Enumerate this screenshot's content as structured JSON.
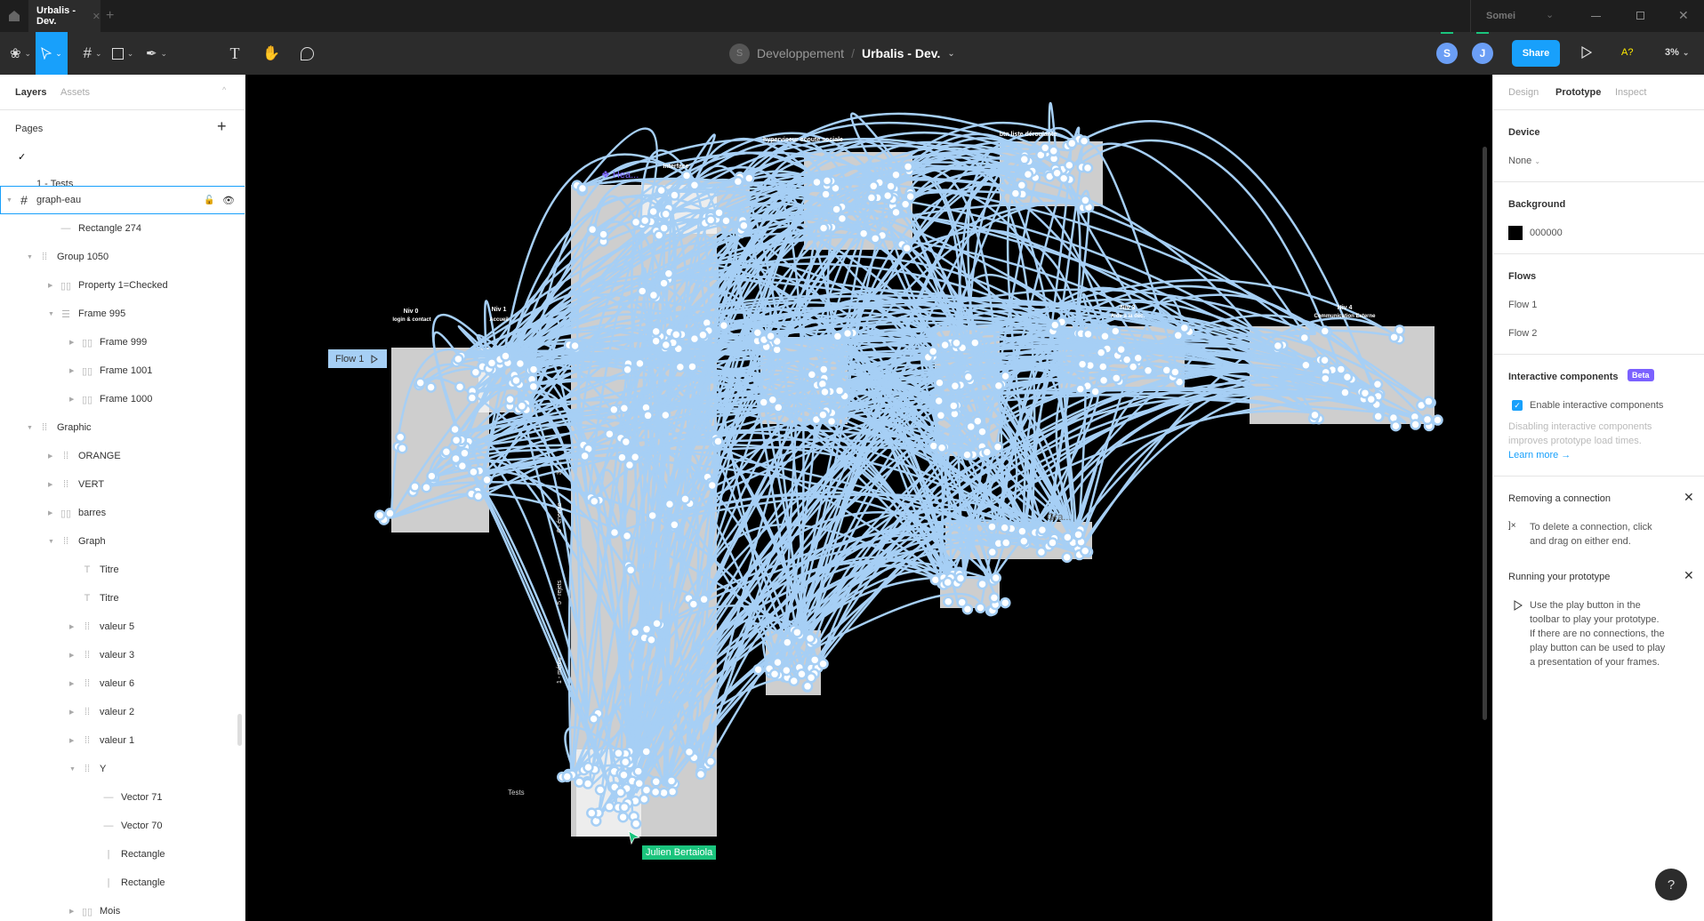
{
  "tabbar": {
    "tab_title": "Urbalis - Dev.",
    "user_menu": "Somei"
  },
  "toolbar": {
    "breadcrumb_team": "Developpement",
    "breadcrumb_sep": "/",
    "file_name": "Urbalis - Dev.",
    "team_avatar": "S",
    "avatars": [
      "S",
      "J"
    ],
    "share": "Share",
    "a11y": "A?",
    "zoom": "3%"
  },
  "left": {
    "tab_layers": "Layers",
    "tab_assets": "Assets",
    "pages_title": "Pages",
    "page_current": "✓",
    "page_partial": "1 - Tests",
    "layers": [
      {
        "label": "graph-eau",
        "icon": "frame",
        "depth": 0,
        "chevron": "open",
        "selected": true
      },
      {
        "label": "Rectangle 274",
        "icon": "line",
        "depth": 2
      },
      {
        "label": "Group 1050",
        "icon": "group",
        "depth": 1,
        "chevron": "open"
      },
      {
        "label": "Property 1=Checked",
        "icon": "autolayout-h",
        "depth": 2,
        "chevron": "closed"
      },
      {
        "label": "Frame 995",
        "icon": "autolayout-v",
        "depth": 2,
        "chevron": "open"
      },
      {
        "label": "Frame 999",
        "icon": "autolayout-h",
        "depth": 3,
        "chevron": "closed"
      },
      {
        "label": "Frame 1001",
        "icon": "autolayout-h",
        "depth": 3,
        "chevron": "closed"
      },
      {
        "label": "Frame 1000",
        "icon": "autolayout-h",
        "depth": 3,
        "chevron": "closed"
      },
      {
        "label": "Graphic",
        "icon": "group",
        "depth": 1,
        "chevron": "open"
      },
      {
        "label": "ORANGE",
        "icon": "group",
        "depth": 2,
        "chevron": "closed"
      },
      {
        "label": "VERT",
        "icon": "group",
        "depth": 2,
        "chevron": "closed"
      },
      {
        "label": "barres",
        "icon": "autolayout-h",
        "depth": 2,
        "chevron": "closed"
      },
      {
        "label": "Graph",
        "icon": "group",
        "depth": 2,
        "chevron": "open"
      },
      {
        "label": "Titre",
        "icon": "text",
        "depth": 3
      },
      {
        "label": "Titre",
        "icon": "text",
        "depth": 3
      },
      {
        "label": "valeur 5",
        "icon": "group",
        "depth": 3,
        "chevron": "closed"
      },
      {
        "label": "valeur 3",
        "icon": "group",
        "depth": 3,
        "chevron": "closed"
      },
      {
        "label": "valeur 6",
        "icon": "group",
        "depth": 3,
        "chevron": "closed"
      },
      {
        "label": "valeur 2",
        "icon": "group",
        "depth": 3,
        "chevron": "closed"
      },
      {
        "label": "valeur 1",
        "icon": "group",
        "depth": 3,
        "chevron": "closed"
      },
      {
        "label": "Y",
        "icon": "group",
        "depth": 3,
        "chevron": "open"
      },
      {
        "label": "Vector 71",
        "icon": "line",
        "depth": 4
      },
      {
        "label": "Vector 70",
        "icon": "line",
        "depth": 4
      },
      {
        "label": "Rectangle",
        "icon": "vline",
        "depth": 4
      },
      {
        "label": "Rectangle",
        "icon": "vline",
        "depth": 4
      },
      {
        "label": "Mois",
        "icon": "autolayout-h",
        "depth": 3,
        "chevron": "closed"
      }
    ]
  },
  "right": {
    "tabs": [
      "Design",
      "Prototype",
      "Inspect"
    ],
    "active_tab": "Prototype",
    "device_title": "Device",
    "device_value": "None",
    "background_title": "Background",
    "background_hex": "000000",
    "background_color": "#000000",
    "flows_title": "Flows",
    "flows": [
      "Flow 1",
      "Flow 2"
    ],
    "ic_title": "Interactive components",
    "ic_badge": "Beta",
    "ic_checkbox": "Enable interactive components",
    "ic_checked": true,
    "ic_desc1": "Disabling interactive components",
    "ic_desc2": "improves prototype load times.",
    "ic_link": "Learn more →",
    "rm_title": "Removing a connection",
    "rm_text1": "To delete a connection, click",
    "rm_text2": "and drag on either end.",
    "run_title": "Running your prototype",
    "run_lines": [
      "Use the play button in the",
      "toolbar to play your prototype.",
      "If there are no connections, the",
      "play button can be used to play",
      "a presentation of your frames."
    ],
    "help": "?"
  },
  "canvas": {
    "labels": {
      "hyperviseur": "hyperviseur ecoute sociale",
      "btn_liste": "btn liste déroulante",
      "interface": "Interface",
      "hea": "Hea...",
      "niv0": "Niv 0",
      "niv0_sub": "login & contact",
      "niv1": "Niv 1",
      "niv1_sub": "Accueil",
      "niv3": "Niv 3",
      "niv3_sub": "Aide à la déc.",
      "niv4": "Niv 4",
      "niv4_sub": "Communication Externe",
      "tests": "Tests",
      "v3": "3 - ...",
      "v6": "6 - énergie",
      "v5": "5 - rejets",
      "v1": "1 - météo",
      "gra": "Gra..."
    },
    "flow_badge": "Flow 1",
    "cursor_user": "Julien Bertaiola",
    "cursor_color": "#1bc47d",
    "connection_color": "#a6cff5"
  },
  "colors": {
    "accent": "#18a0fb",
    "beta": "#7b61ff",
    "avatar": "#6b9ef5",
    "presence": "#1bc47d",
    "a11y": "#ffeb00"
  }
}
